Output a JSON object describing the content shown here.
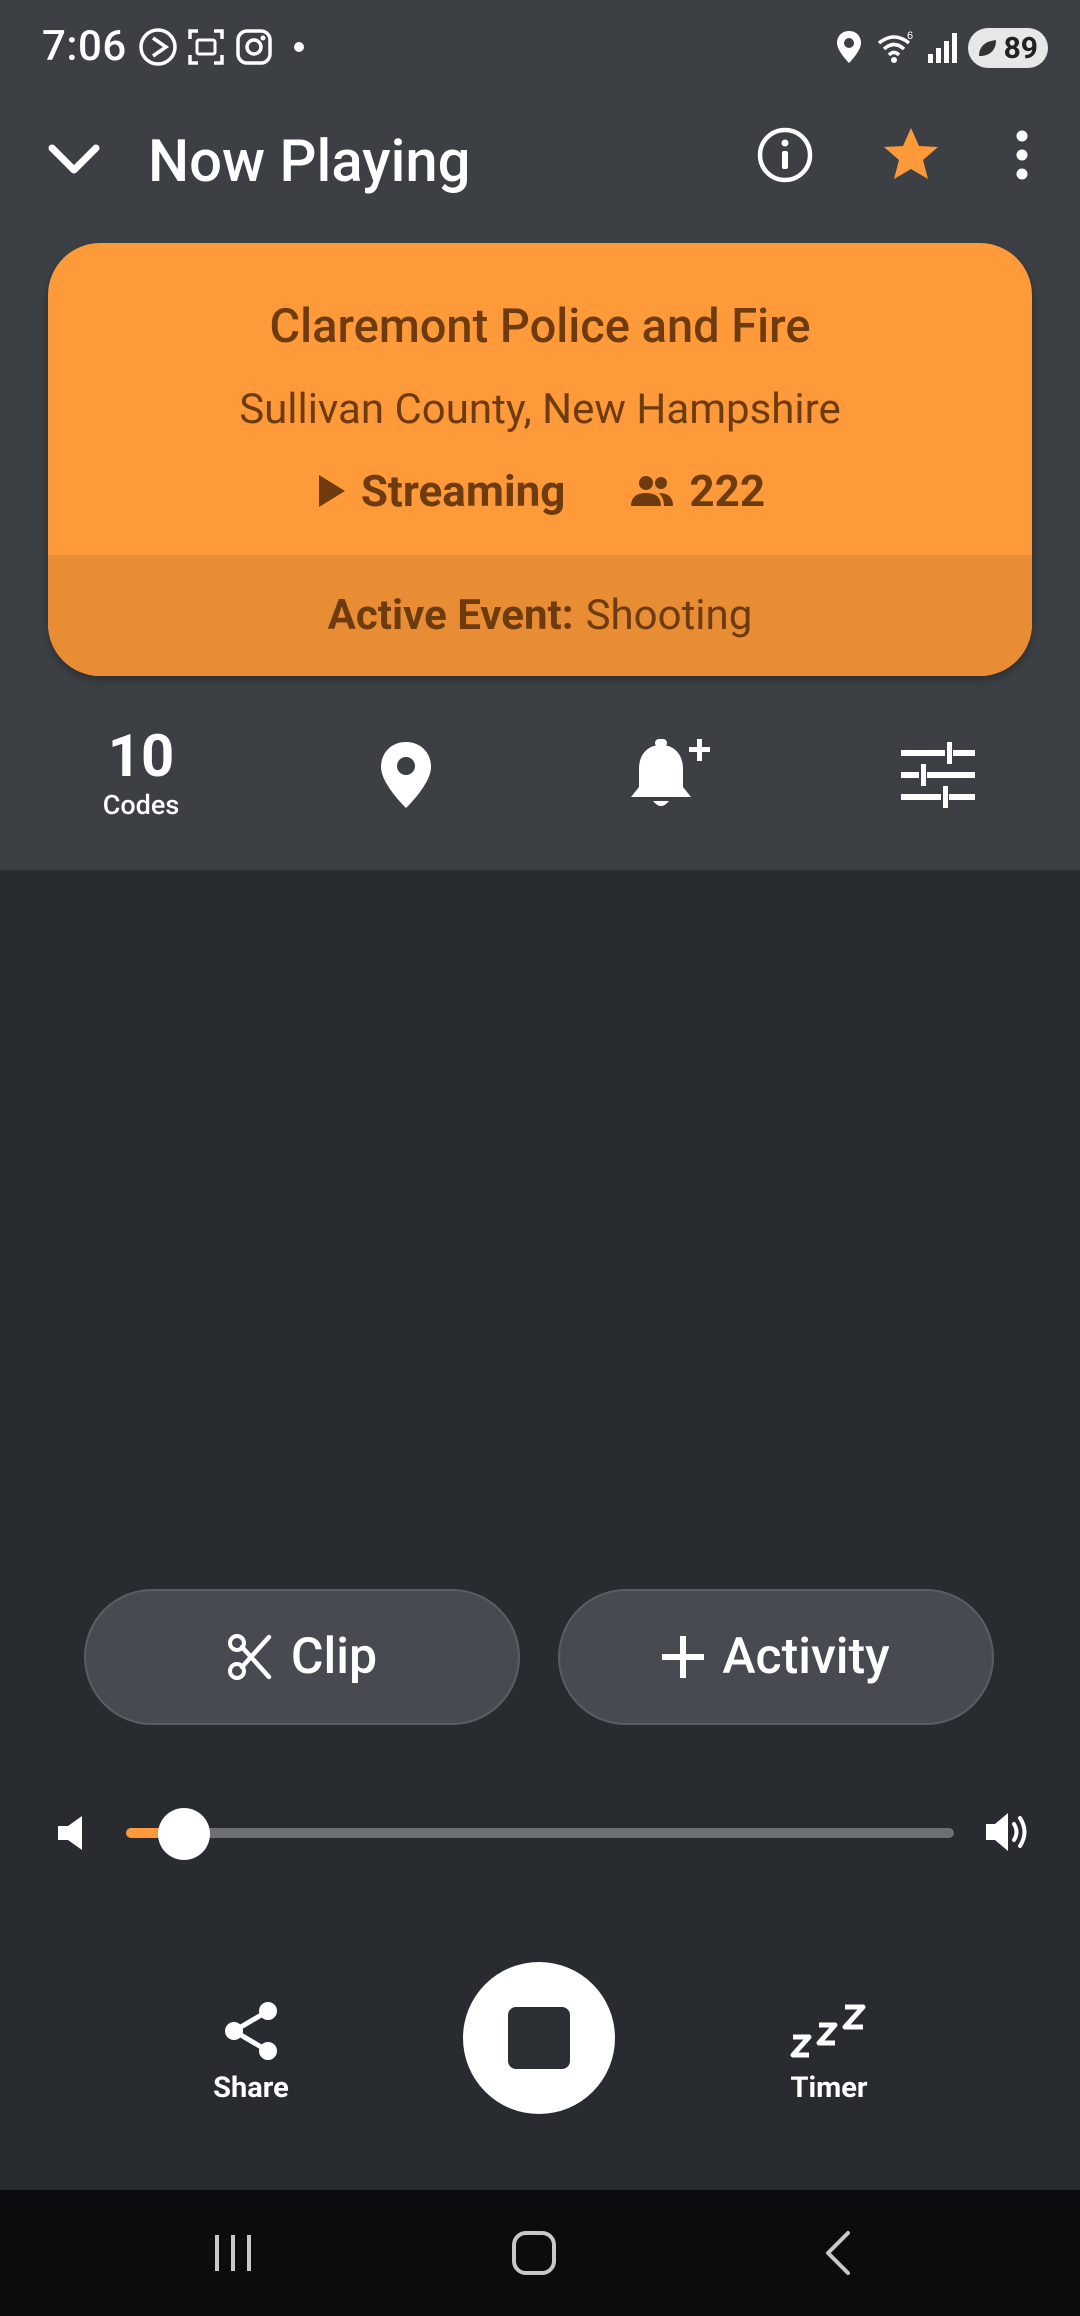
{
  "status_bar": {
    "time": "7:06",
    "battery": "89"
  },
  "header": {
    "title": "Now Playing"
  },
  "feed": {
    "name": "Claremont Police and Fire",
    "location": "Sullivan County, New Hampshire",
    "status": "Streaming",
    "listeners": "222",
    "active_event_label": "Active Event:",
    "active_event_value": "Shooting"
  },
  "quick_actions": {
    "codes_count": "10",
    "codes_label": "Codes"
  },
  "buttons": {
    "clip": "Clip",
    "activity": "Activity"
  },
  "volume": {
    "level_percent": 7
  },
  "controls": {
    "share": "Share",
    "timer": "Timer"
  },
  "colors": {
    "accent": "#fe9a3a",
    "card_text": "#6e3b0e",
    "background": "#282c31",
    "header_bg": "#3c3f43"
  }
}
